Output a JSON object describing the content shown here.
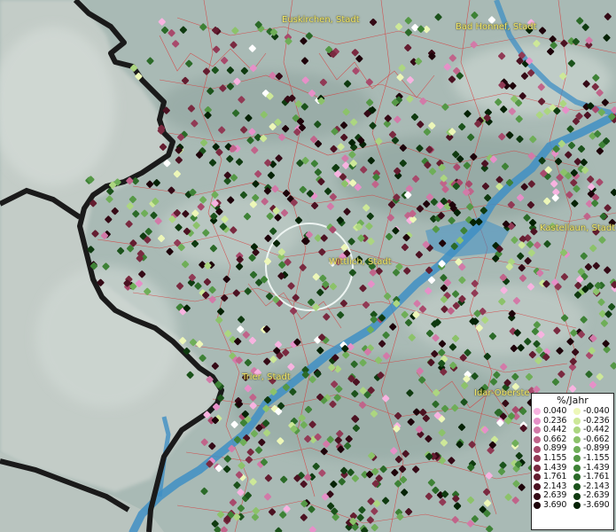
{
  "map": {
    "places": [
      {
        "name": "Euskirchen, Stadt",
        "id": "place-euskirchen"
      },
      {
        "name": "Bad Honnef, Stadt",
        "id": "place-bad-honnef"
      },
      {
        "name": "Kastellaun, Stadt",
        "id": "place-kastellaun"
      },
      {
        "name": "Wittlich, Stadt",
        "id": "place-wittlich"
      },
      {
        "name": "Trier, Stadt",
        "id": "place-trier"
      },
      {
        "name": "Idar-Oberste",
        "id": "place-idar-oberstein"
      }
    ],
    "colors": {
      "terrain": "#a9bab5",
      "border": "#1a1a1a",
      "admin_lines": "#d83a3a",
      "river": "#3f8fc4",
      "label": "#f3e86a"
    }
  },
  "legend": {
    "title": "%/Jahr",
    "positive": [
      {
        "value": "0.040",
        "color": "#f7b3e0"
      },
      {
        "value": "0.236",
        "color": "#e690c8"
      },
      {
        "value": "0.442",
        "color": "#d27aa8"
      },
      {
        "value": "0.662",
        "color": "#c0648a"
      },
      {
        "value": "0.899",
        "color": "#a84a6c"
      },
      {
        "value": "1.155",
        "color": "#913a55"
      },
      {
        "value": "1.439",
        "color": "#7a2a40"
      },
      {
        "value": "1.761",
        "color": "#641d30"
      },
      {
        "value": "2.143",
        "color": "#4c1222"
      },
      {
        "value": "2.639",
        "color": "#350a16"
      },
      {
        "value": "3.690",
        "color": "#1e030a"
      }
    ],
    "negative": [
      {
        "value": "-0.040",
        "color": "#edf7b8"
      },
      {
        "value": "-0.236",
        "color": "#cde898"
      },
      {
        "value": "-0.442",
        "color": "#acd680"
      },
      {
        "value": "-0.662",
        "color": "#8cc26a"
      },
      {
        "value": "-0.899",
        "color": "#6fae58"
      },
      {
        "value": "-1.155",
        "color": "#559846"
      },
      {
        "value": "-1.439",
        "color": "#3e8236"
      },
      {
        "value": "-1.761",
        "color": "#2b6a28"
      },
      {
        "value": "-2.143",
        "color": "#1b521b"
      },
      {
        "value": "-2.639",
        "color": "#0f3a10"
      },
      {
        "value": "-3.690",
        "color": "#052205"
      }
    ]
  }
}
